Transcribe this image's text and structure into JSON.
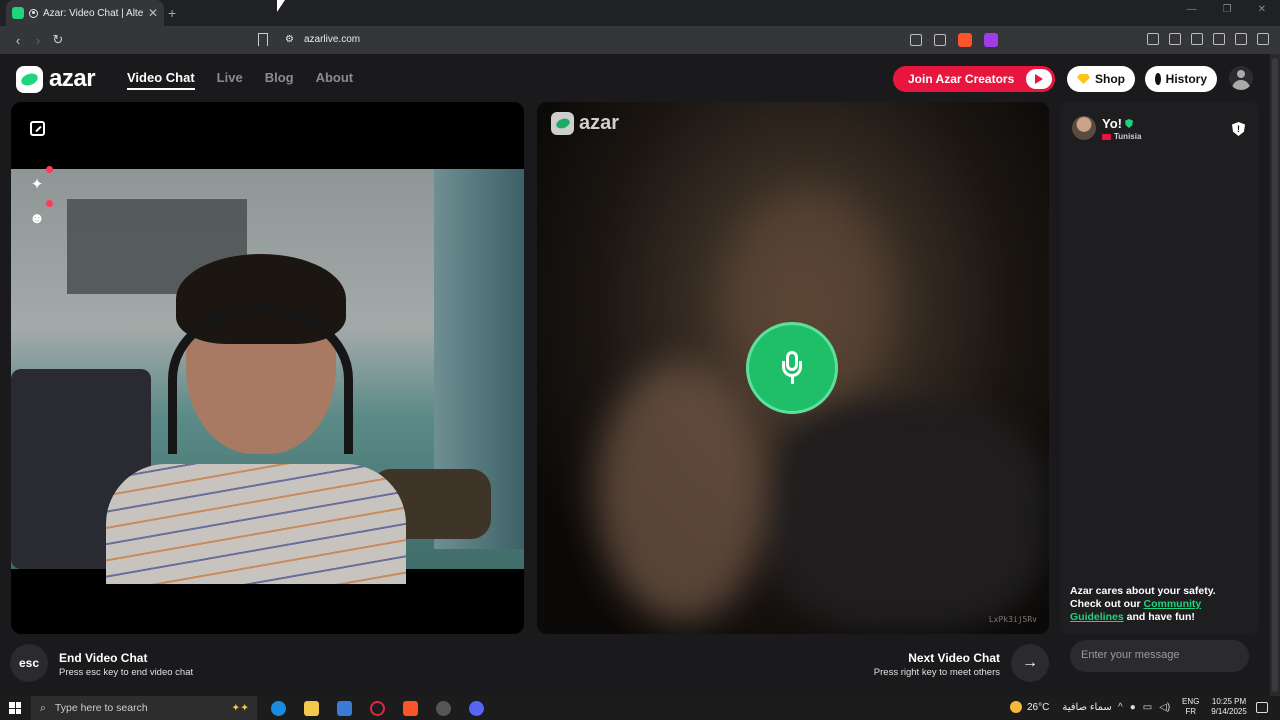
{
  "browser": {
    "tab_title": "Azar: Video Chat | Alternative",
    "url": "azarlive.com"
  },
  "header": {
    "logo_text": "azar",
    "nav": [
      "Video Chat",
      "Live",
      "Blog",
      "About"
    ],
    "creators_label": "Join Azar Creators",
    "shop_label": "Shop",
    "history_label": "History"
  },
  "video": {
    "watermark": "azar",
    "session_code": "LxPk3ij5Rv"
  },
  "controls": {
    "esc_key": "esc",
    "end_title": "End Video Chat",
    "end_sub": "Press esc key to end video chat",
    "next_title": "Next Video Chat",
    "next_sub": "Press right key to meet others",
    "next_icon": "→"
  },
  "chat": {
    "partner_name": "Yo!",
    "partner_country": "Tunisia",
    "safety_text_1": "Azar cares about your safety. Check out our ",
    "safety_link": "Community Guidelines",
    "safety_text_2": " and have fun!",
    "message_placeholder": "Enter your message"
  },
  "taskbar": {
    "search_placeholder": "Type here to search",
    "temperature": "26°C",
    "weather_text": "سماء صافية",
    "lang_1": "ENG",
    "lang_2": "FR",
    "time": "10:25 PM",
    "date": "9/14/2025"
  },
  "colors": {
    "brand_green": "#1fd47a",
    "creators_red": "#e8163f",
    "page_bg": "#1a1a1d"
  }
}
